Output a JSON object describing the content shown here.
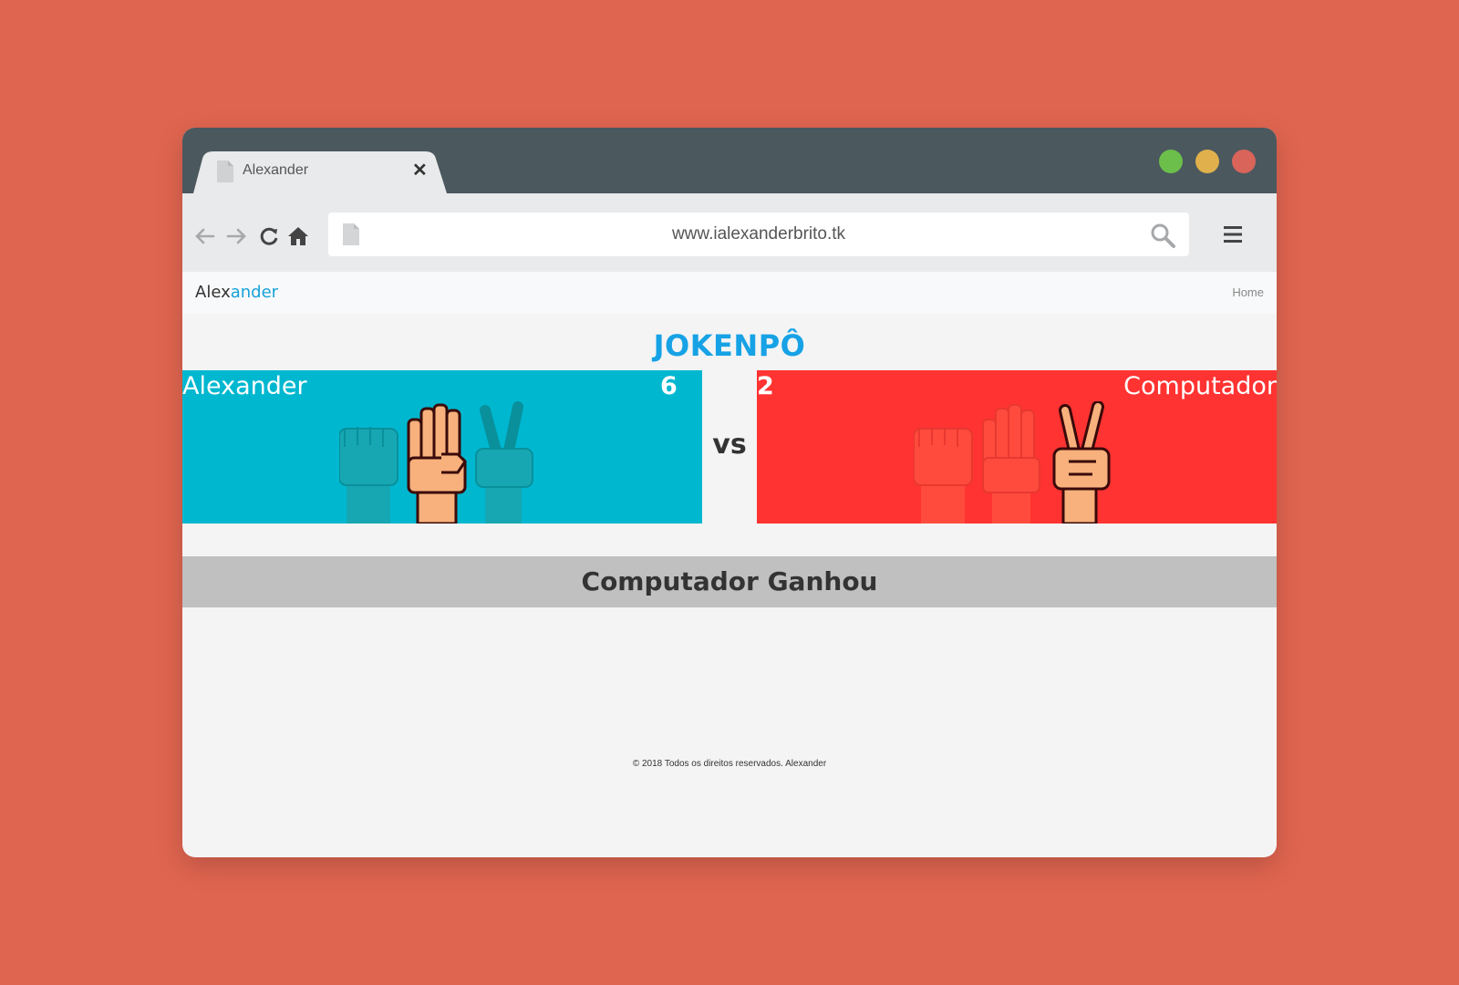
{
  "colors": {
    "background": "#e06550",
    "titlebar": "#4b585e",
    "player_panel": "#00b7d0",
    "computer_panel": "#ff3332",
    "accent": "#17a2e6",
    "result_bar": "#c0c0c0"
  },
  "browser": {
    "tab_title": "Alexander",
    "tab_icon": "document-icon",
    "close_icon": "close-icon",
    "url": "www.ialexanderbrito.tk",
    "window_controls": [
      "green-dot",
      "yellow-dot",
      "red-dot"
    ],
    "nav_icons": [
      "back-arrow-icon",
      "forward-arrow-icon",
      "reload-icon",
      "home-icon"
    ],
    "search_icon": "search-icon",
    "menu_icon": "hamburger-menu-icon"
  },
  "site": {
    "brand_part1": "Alex",
    "brand_part2": "ander",
    "nav_home": "Home"
  },
  "game": {
    "title": "JOKENPÔ",
    "vs": "vs",
    "player": {
      "name": "Alexander",
      "score": "6",
      "choice": "paper"
    },
    "computer": {
      "name": "Computador",
      "score": "2",
      "choice": "scissors"
    },
    "result": "Computador Ganhou"
  },
  "footer": {
    "text": "© 2018 Todos os direitos reservados. Alexander"
  }
}
